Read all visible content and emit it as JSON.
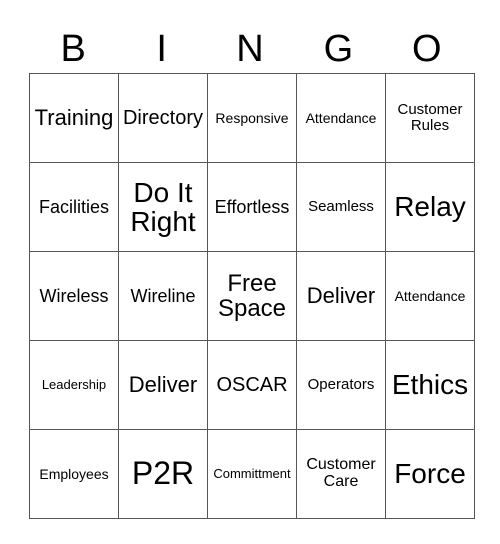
{
  "header": {
    "letters": [
      "B",
      "I",
      "N",
      "G",
      "O"
    ]
  },
  "grid": {
    "rows": [
      [
        "Training",
        "Directory",
        "Responsive",
        "Attendance",
        "Customer Rules"
      ],
      [
        "Facilities",
        "Do It Right",
        "Effortless",
        "Seamless",
        "Relay"
      ],
      [
        "Wireless",
        "Wireline",
        "Free Space",
        "Deliver",
        "Attendance"
      ],
      [
        "Leadership",
        "Deliver",
        "OSCAR",
        "Operators",
        "Ethics"
      ],
      [
        "Employees",
        "P2R",
        "Committment",
        "Customer Care",
        "Force"
      ]
    ]
  }
}
